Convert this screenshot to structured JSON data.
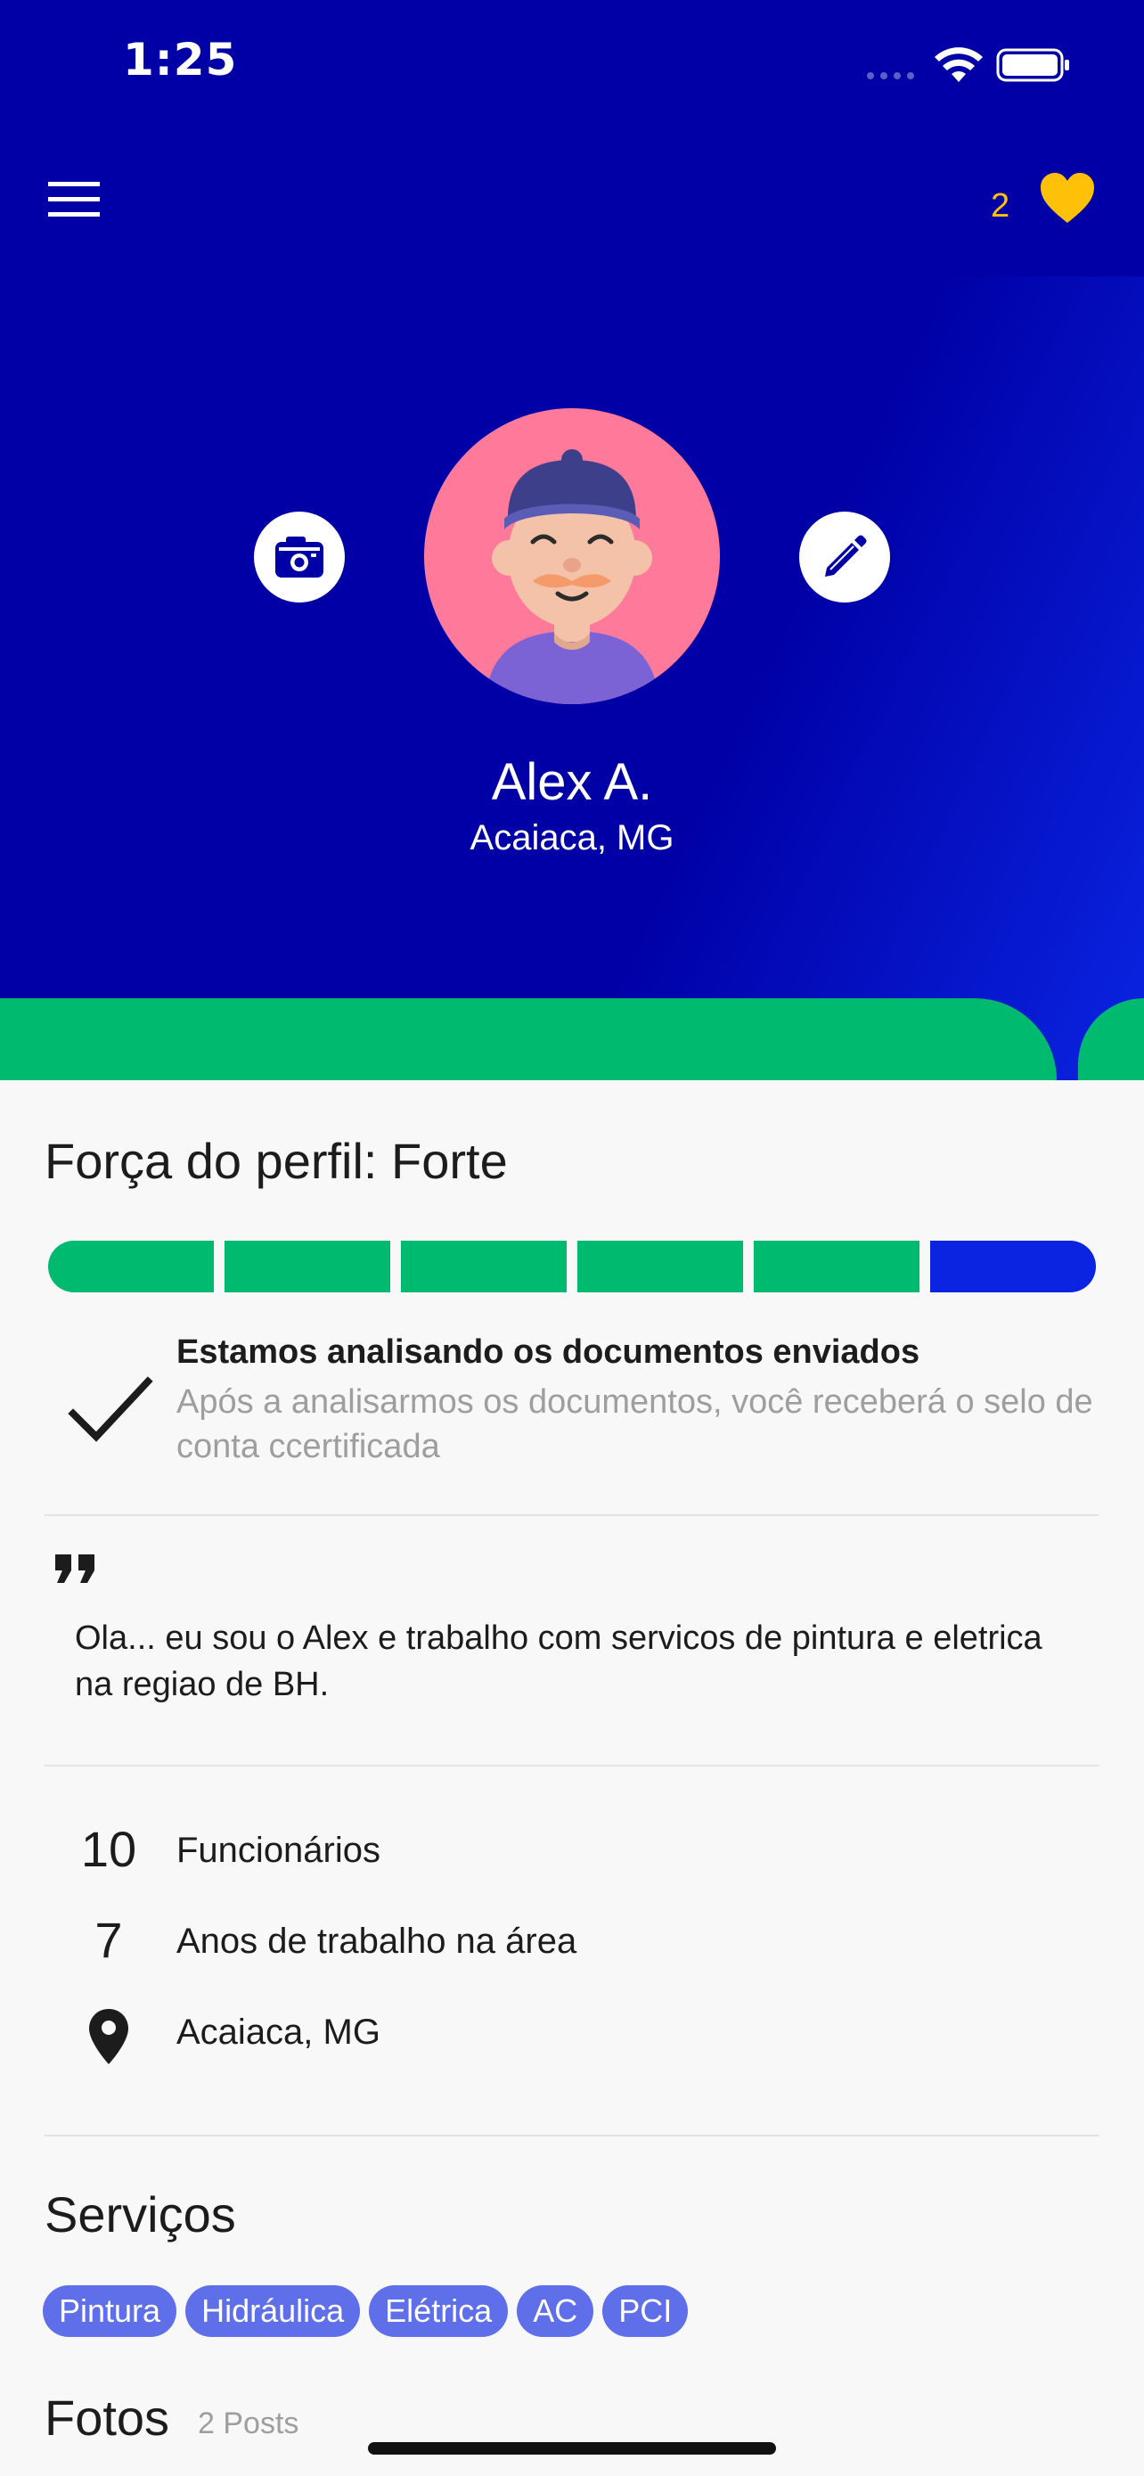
{
  "status_bar": {
    "time": "1:25"
  },
  "app_bar": {
    "favorites_count": "2"
  },
  "profile": {
    "name": "Alex A.",
    "location": "Acaiaca, MG"
  },
  "strength": {
    "title": "Força do perfil: Forte",
    "segments_total": 6,
    "segments_filled": 5,
    "filled_color": "#00bb6f",
    "pending_color": "#0a24e2"
  },
  "verification": {
    "title": "Estamos analisando os documentos enviados",
    "description": "Após a analisarmos os documentos, você receberá o selo de conta ccertificada"
  },
  "bio": {
    "text": "Ola... eu sou o Alex e trabalho com servicos de pintura e eletrica na regiao de BH."
  },
  "stats": {
    "employees": {
      "value": "10",
      "label": "Funcionários"
    },
    "years": {
      "value": "7",
      "label": "Anos de trabalho na área"
    },
    "location": {
      "label": "Acaiaca, MG"
    }
  },
  "services": {
    "title": "Serviços",
    "items": [
      "Pintura",
      "Hidráulica",
      "Elétrica",
      "AC",
      "PCI"
    ]
  },
  "photos": {
    "title": "Fotos",
    "count": "2 Posts"
  },
  "icons": {
    "menu": "menu-icon",
    "heart": "heart-icon",
    "camera": "camera-icon",
    "edit": "pencil-icon",
    "check": "check-icon",
    "quote": "quote-icon",
    "pin": "location-pin-icon"
  },
  "colors": {
    "header_blue": "#0000a6",
    "accent_blue": "#0a24e2",
    "green": "#00bb6f",
    "heart_gold": "#ffc107",
    "chip": "#5f6fea"
  }
}
